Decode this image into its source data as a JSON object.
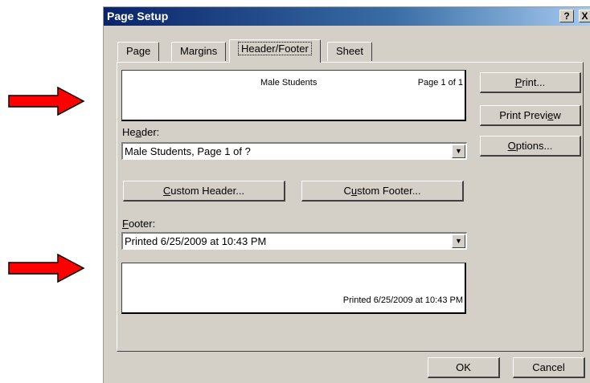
{
  "dialog": {
    "title": "Page Setup",
    "help_glyph": "?",
    "close_glyph": "X"
  },
  "tabs": [
    {
      "label": "Page"
    },
    {
      "label": "Margins"
    },
    {
      "label": "Header/Footer"
    },
    {
      "label": "Sheet"
    }
  ],
  "header_preview": {
    "center_text": "Male Students",
    "right_text": "Page 1 of 1"
  },
  "header": {
    "label": "Header:",
    "value": "Male  Students, Page 1 of ?"
  },
  "buttons": {
    "custom_header": "Custom Header...",
    "custom_footer": "Custom Footer...",
    "print": "Print...",
    "print_preview": "Print Preview",
    "options": "Options...",
    "ok": "OK",
    "cancel": "Cancel"
  },
  "footer": {
    "label": "Footer:",
    "value": "Printed 6/25/2009 at 10:43 PM"
  },
  "footer_preview": {
    "right_text": "Printed 6/25/2009 at 10:43 PM"
  },
  "colors": {
    "arrow": "#ff0000",
    "titlebar_start": "#0a246a",
    "titlebar_end": "#a6caf0",
    "dialog_face": "#d4d0c8"
  },
  "icons": {
    "annotation": "red-right-arrow",
    "dropdown": "triangle-down"
  }
}
